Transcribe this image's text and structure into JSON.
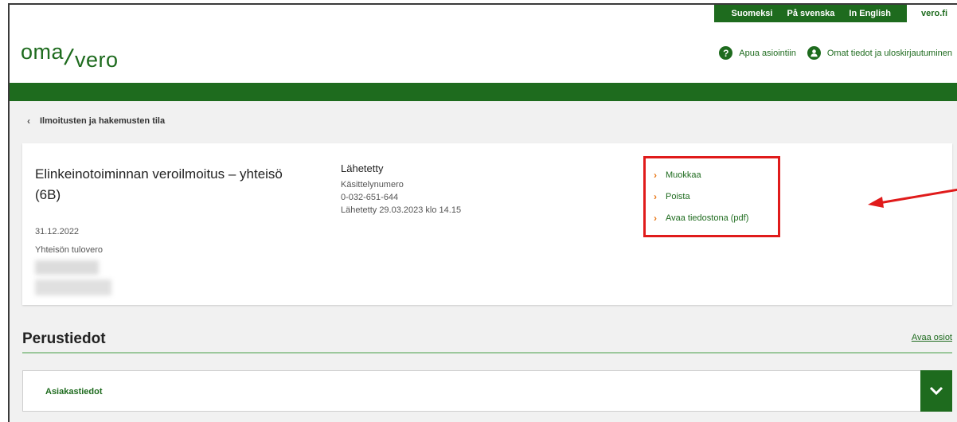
{
  "languages": [
    "Suomeksi",
    "På svenska",
    "In English"
  ],
  "site_link": "vero.fi",
  "logo": {
    "part1": "oma",
    "slash": "/",
    "part2": "vero"
  },
  "header_links": {
    "help": "Apua asiointiin",
    "help_icon": "question-icon",
    "account": "Omat tiedot ja uloskirjautuminen",
    "account_icon": "user-icon"
  },
  "breadcrumb": {
    "back_label": "Ilmoitusten ja hakemusten tila"
  },
  "filing": {
    "title": "Elinkeinotoiminnan veroilmoitus – yhteisö (6B)",
    "date": "31.12.2022",
    "tax_type": "Yhteisön tulovero",
    "status": "Lähetetty",
    "case_number_label": "Käsittelynumero",
    "case_number": "0-032-651-644",
    "sent_info": "Lähetetty 29.03.2023 klo 14.15"
  },
  "actions": [
    "Muokkaa",
    "Poista",
    "Avaa tiedostona (pdf)"
  ],
  "section": {
    "title": "Perustiedot",
    "open_all": "Avaa osiot"
  },
  "accordion": {
    "label": "Asiakastiedot"
  },
  "colors": {
    "brand_green": "#1e6b1e",
    "accent_orange": "#e8791a",
    "highlight_red": "#e01b1b"
  }
}
